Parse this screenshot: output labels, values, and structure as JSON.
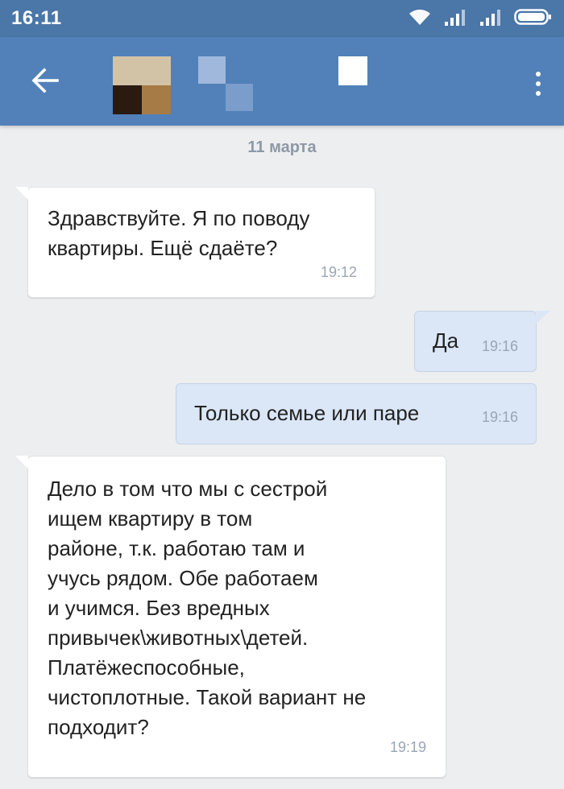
{
  "status_bar": {
    "time": "16:11",
    "icons": [
      "wifi-icon",
      "signal-icon",
      "signal-icon",
      "battery-icon"
    ]
  },
  "header": {
    "back_icon": "arrow-left-icon",
    "menu_icon": "more-vertical-icon"
  },
  "chat": {
    "date_separator": "11 марта",
    "messages": [
      {
        "direction": "incoming",
        "lines": [
          "Здравствуйте. Я по поводу",
          "квартиры. Ещё сдаёте?"
        ],
        "time": "19:12"
      },
      {
        "direction": "outgoing",
        "lines": [
          "Да"
        ],
        "time": "19:16"
      },
      {
        "direction": "outgoing",
        "lines": [
          "Только семье или паре"
        ],
        "time": "19:16"
      },
      {
        "direction": "incoming",
        "lines": [
          "Дело в том что мы с сестрой",
          "ищем квартиру в том",
          "районе, т.к. работаю там и",
          "учусь рядом. Обе работаем",
          "и учимся. Без вредных",
          "привычек\\животных\\детей.",
          "Платёжеспособные,",
          "чистоплотные. Такой вариант не",
          "подходит?"
        ],
        "time": "19:19"
      }
    ]
  },
  "colors": {
    "header": "#5181b8",
    "status_bar": "#4a76a8",
    "background": "#edeef0",
    "incoming_bubble": "#ffffff",
    "outgoing_bubble": "#dbe7f6"
  }
}
